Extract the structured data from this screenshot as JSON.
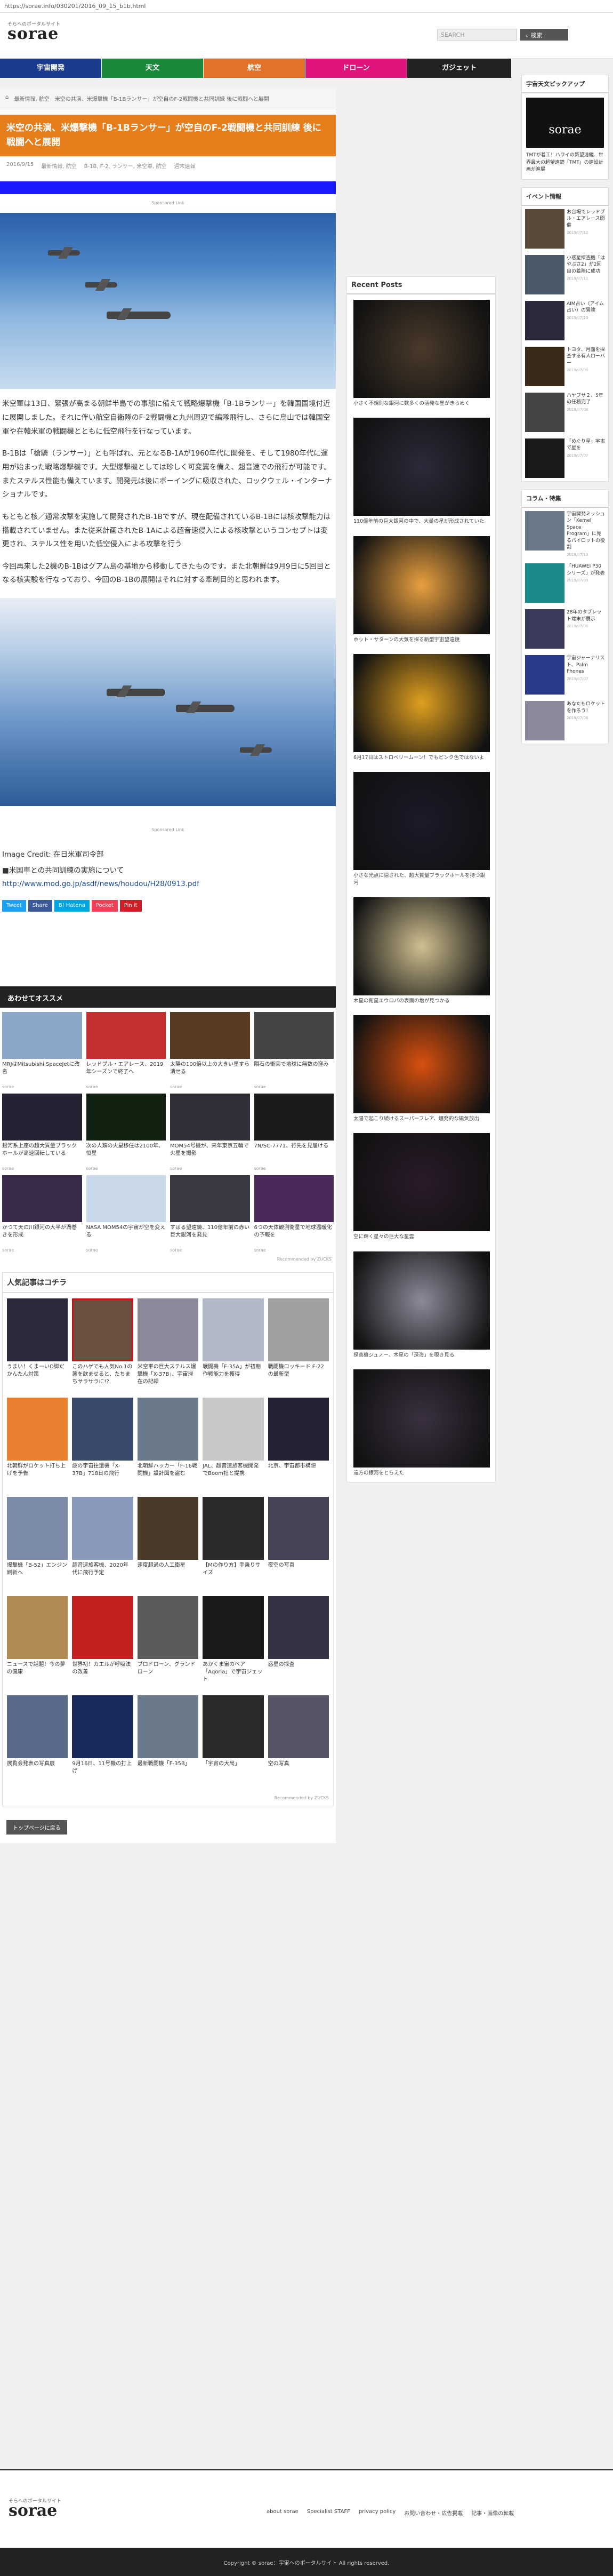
{
  "url": "https://sorae.info/030201/2016_09_15_b1b.html",
  "header": {
    "logo_sub": "そらへのポータルサイト",
    "logo": "sorae",
    "search_placeholder": "SEARCH",
    "search_button": "検索"
  },
  "nav": [
    {
      "label": "宇宙開発",
      "color": "#1b3c8c"
    },
    {
      "label": "天文",
      "color": "#1a8a3a"
    },
    {
      "label": "航空",
      "color": "#e2722a"
    },
    {
      "label": "ドローン",
      "color": "#e0127c"
    },
    {
      "label": "ガジェット",
      "color": "#222222"
    }
  ],
  "breadcrumb": [
    "ホーム",
    "最新情報, 航空",
    "米空の共演、米爆撃機「B-1Bランサー」が空自のF-2戦闘機と共同訓練 後に戦闘へと展開"
  ],
  "article": {
    "title": "米空の共演、米爆撃機「B-1Bランサー」が空自のF-2戦闘機と共同訓練 後に戦闘へと展開",
    "date": "2016/9/15",
    "category": "最新情報, 航空",
    "tags": "B-1B, F-2, ランサー, 米空軍, 航空",
    "author": "週末速報",
    "ad_label": "Sponsored Link",
    "p1": "米空軍は13日、緊張が高まる朝鮮半島での事態に備えて戦略爆撃機「B-1Bランサー」を韓国国境付近に展開しました。それに伴い航空自衛隊のF-2戦闘機と九州周辺で編隊飛行し、さらに烏山では韓国空軍や在韓米軍の戦闘機とともに低空飛行を行なっています。",
    "p2": "B-1Bは「槍騎（ランサー）」とも呼ばれ、元となるB-1Aが1960年代に開発を、そして1980年代に運用が始まった戦略爆撃機です。大型爆撃機としては珍しく可変翼を備え、超音速での飛行が可能です。またステルス性能も備えています。開発元は後にボーイングに吸収された、ロックウェル・インターナショナルです。",
    "p3": "もともと核／通常攻撃を実施して開発されたB-1Bですが、現在配備されているB-1Bには核攻撃能力は搭載されていません。また従来計画されたB-1Aによる超音速侵入による核攻撃というコンセプトは変更され、ステルス性を用いた低空侵入による攻撃を行う",
    "p4": "今回再来した2機のB-1Bはグアム島の基地から移動してきたものです。また北朝鮮は9月9日に5回目となる核実験を行なっており、今回のB-1Bの展開はそれに対する牽制目的と思われます。",
    "credit": "Image Credit: 在日米軍司令部",
    "source_note": "■米国車との共同訓練の実施について",
    "source_url": "http://www.mod.go.jp/asdf/news/houdou/H28/0913.pdf",
    "share": [
      {
        "label": "Tweet",
        "color": "#1da1f2"
      },
      {
        "label": "Share",
        "color": "#3b5998"
      },
      {
        "label": "B! Hatena",
        "color": "#00a4de"
      },
      {
        "label": "Pocket",
        "color": "#ee4056"
      },
      {
        "label": "Pin it",
        "color": "#cb2027"
      }
    ]
  },
  "recommend": {
    "title": "あわせてオススメ",
    "items": [
      {
        "t": "MRJはMitsubishi SpaceJetに改名",
        "s": "sorae",
        "c": "#8aa7c8"
      },
      {
        "t": "レッドブル・エアレース、2019年シーズンで終了へ",
        "s": "sorae",
        "c": "#c43030"
      },
      {
        "t": "太陽の100倍以上の大きい星すら潰せる",
        "s": "sorae",
        "c": "#5a3a20"
      },
      {
        "t": "隕石の衝突で地球に無数の窪み",
        "s": "sorae",
        "c": "#444444"
      },
      {
        "t": "銀河系上座の超大質量ブラックホールが高速回転している",
        "s": "sorae",
        "c": "#222233"
      },
      {
        "t": "次の人類の火星移住は2100年、恒星",
        "s": "sorae",
        "c": "#112211"
      },
      {
        "t": "MOM54号機が、来年東京五輪で火星を撮影",
        "s": "sorae",
        "c": "#303038"
      },
      {
        "t": "7N/SC-7771、行先を見届ける",
        "s": "sorae",
        "c": "#1a1a1a"
      },
      {
        "t": "かつて天の川銀河の大半が渦巻きを形成",
        "s": "sorae",
        "c": "#3a2a4a"
      },
      {
        "t": "NASA MOM54の宇宙が空を変える",
        "s": "sorae",
        "c": "#c8d8e8"
      },
      {
        "t": "すばる望遠鏡、110億年前の赤い巨大銀河を発見",
        "s": "sorae",
        "c": "#3a3a44"
      },
      {
        "t": "6つの天体観測衛星で地球温暖化の予報を",
        "s": "sorae",
        "c": "#4a2a5a"
      }
    ],
    "footnote": "Recommended by ZUCKS"
  },
  "popular": {
    "title": "人気記事はコチラ",
    "items": [
      {
        "t": "うまい！くまーいO脚だかんたん対策",
        "c": "#2a2a3a"
      },
      {
        "t": "このハゲでも人気No.1の薬を飲ませると、たちまちサラサラに!?",
        "c": "#6a5040"
      },
      {
        "t": "米空軍の巨大ステルス爆撃機「X-37B」、宇宙滞在の記録",
        "c": "#8a8a9a"
      },
      {
        "t": "戦闘機「F-35A」が初期作戦能力を獲得",
        "c": "#b0b8c8"
      },
      {
        "t": "戦闘機ロッキード F-22の最新型",
        "c": "#a0a0a0"
      },
      {
        "t": "北朝鮮がロケット打ち上げを予告",
        "c": "#e88030"
      },
      {
        "t": "謎の宇宙往還機「X-37B」718日の飛行",
        "c": "#3a4a6a"
      },
      {
        "t": "北朝鮮ハッカー「F-16戦闘機」設計図を盗む",
        "c": "#6a7a8a"
      },
      {
        "t": "JAL、超音速旅客機開発でBoom社と提携",
        "c": "#c8c8c8"
      },
      {
        "t": "北京、宇宙都市構想",
        "c": "#223"
      },
      {
        "t": "爆撃機「B-52」エンジン刷新へ",
        "c": "#7a8aa8"
      },
      {
        "t": "超音速旅客機、2020年代に飛行予定",
        "c": "#8898b8"
      },
      {
        "t": "速度超過の人工衛星",
        "c": "#4a3a2a"
      },
      {
        "t": "【Mの作り方】手乗りサイズ",
        "c": "#2a2a2a"
      },
      {
        "t": "夜空の写真",
        "c": "#445"
      },
      {
        "t": "ニュースで話題！今の夢の健康",
        "c": "#b08a50"
      },
      {
        "t": "世界初！カエルが呼吸法の改善",
        "c": "#c02020"
      },
      {
        "t": "ブロドローン、グランドローン",
        "c": "#5a5a5a"
      },
      {
        "t": "あかくま宙のペア「Aqoria」で宇宙ジェット",
        "c": "#1a1a1a"
      },
      {
        "t": "惑星の探査",
        "c": "#334"
      },
      {
        "t": "展覧会発表の写真展",
        "c": "#5a6a8a"
      },
      {
        "t": "9月16日、11号機の打上げ",
        "c": "#1a2a5a"
      },
      {
        "t": "最新戦闘機「F-35B」",
        "c": "#6a7a8a"
      },
      {
        "t": "「宇宙の大局」",
        "c": "#2a2a2a"
      },
      {
        "t": "空の写真",
        "c": "#556"
      }
    ],
    "footnote": "Recommended by ZUCKS",
    "more": "トップページに戻る"
  },
  "recent": {
    "title": "Recent Posts",
    "items": [
      {
        "cap": "小さく不規則な銀河に数多くの活発な星がきらめく",
        "c": "#4a3a2a"
      },
      {
        "cap": "110億年前の巨大銀河の中で、大量の星が形成されていた",
        "c": "#2a2a3a"
      },
      {
        "cap": "ホット・サターンの大気を探る新型宇宙望遠鏡",
        "c": "#e8a040"
      },
      {
        "cap": "6月17日はストロベリームーン！でもピンク色ではないよ",
        "c": "#e0a020"
      },
      {
        "cap": "小さな光点に隠された、超大質量ブラックホールを持つ銀河",
        "c": "#1a1a2a"
      },
      {
        "cap": "木星の衛星エウロパの表面の塩が見つかる",
        "c": "#d0c090"
      },
      {
        "cap": "太陽で起こり続けるスーパーフレア、爆発的な磁気放出",
        "c": "#d85010"
      },
      {
        "cap": "空に輝く星々の巨大な星雲",
        "c": "#2a1a2a"
      },
      {
        "cap": "探査機ジュノー、木星の「深海」を覗き見る",
        "c": "#8a8a9a"
      },
      {
        "cap": "遠方の銀河をとらえた",
        "c": "#3a3040"
      }
    ]
  },
  "right": {
    "pickup_title": "宇宙天文ピックアップ",
    "banner_text": "sorae",
    "pickup_text": "TMTが着工！ハワイの新望遠鏡、世界最大の超望遠鏡「TMT」の建設計画が進展",
    "event_title": "イベント情報",
    "events": [
      {
        "t": "お台場でレッドブル・エアレース開催",
        "d": "2019/07/12",
        "c": "#5a4a3a"
      },
      {
        "t": "小惑星探査機「はやぶさ2」が2回目の着陸に成功",
        "d": "2019/07/11",
        "c": "#4a5a6a"
      },
      {
        "t": "AIM占い（アイム占い）の冒険",
        "d": "2019/07/10",
        "c": "#2a2a3a"
      },
      {
        "t": "トヨタ、月面を探査する有人ローバー",
        "d": "2019/07/09",
        "c": "#3a2a1a"
      },
      {
        "t": "ハヤブサ２、5年の任務完了",
        "d": "2019/07/08",
        "c": "#444"
      },
      {
        "t": "「めぐり星」宇宙で星を",
        "d": "2019/07/07",
        "c": "#1a1a1a"
      }
    ],
    "column_title": "コラム・特集",
    "columns": [
      {
        "t": "宇宙開発ミッション「Kernel Space Program」に見るパイロットの役割",
        "d": "2019/07/10",
        "c": "#6a7a8a"
      },
      {
        "t": "「HUAWEI P30シリーズ」が発表",
        "d": "2019/07/09",
        "c": "#1a8a8a"
      },
      {
        "t": "28年のタブレット端末が展示",
        "d": "2019/07/08",
        "c": "#3a3a5a"
      },
      {
        "t": "宇宙ジャーナリスト、Palm Phones",
        "d": "2019/07/07",
        "c": "#2a3a8a"
      },
      {
        "t": "あなたもロケットを作ろう！",
        "d": "2019/07/06",
        "c": "#8a8a9a"
      }
    ]
  },
  "footer": {
    "logo_sub": "そらへのポータルサイト",
    "logo": "sorae",
    "links": [
      "about sorae",
      "Specialist STAFF",
      "privacy policy",
      "お問い合わせ・広告掲載",
      "記事・画像の転載"
    ],
    "copyright": "Copyright © sorae：宇宙へのポータルサイト All rights reserved."
  }
}
